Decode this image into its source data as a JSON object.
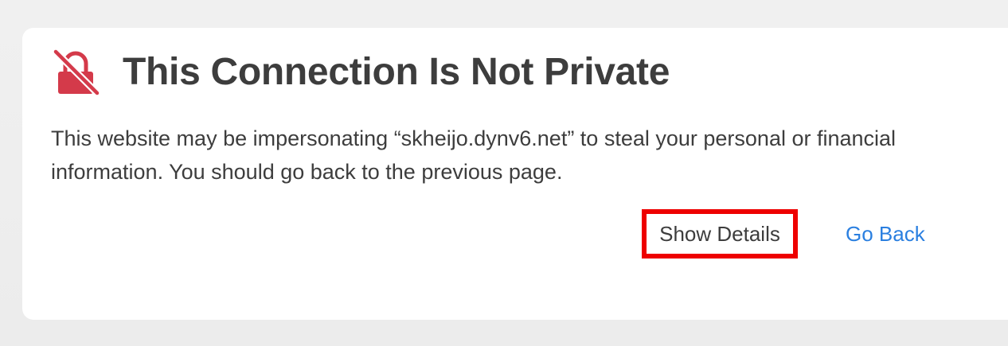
{
  "warning": {
    "icon": "broken-lock-icon",
    "icon_color": "#d43a4a",
    "title": "This Connection Is Not Private",
    "message": "This website may be impersonating “skheijo.dynv6.net” to steal your personal or financial information. You should go back to the previous page."
  },
  "actions": {
    "show_details_label": "Show Details",
    "go_back_label": "Go Back",
    "link_color": "#2a7fe0",
    "highlight_color": "#ee0000"
  }
}
